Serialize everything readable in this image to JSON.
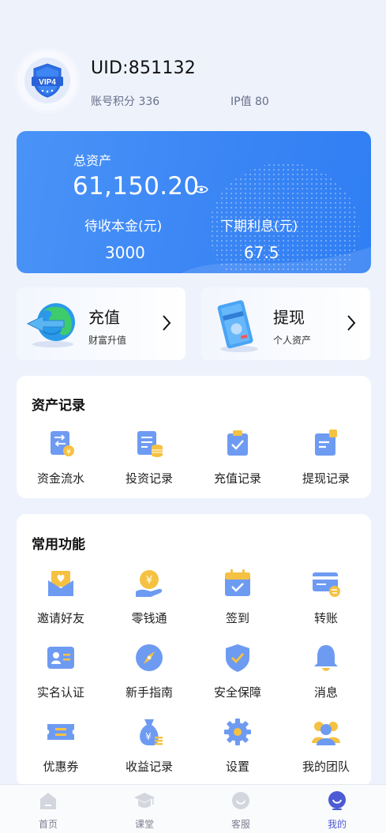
{
  "profile": {
    "uid": "UID:851132",
    "score": "账号积分 336",
    "ip": "IP值 80",
    "badge_text": "VIP4"
  },
  "assets": {
    "total_label": "总资产",
    "total_value": "61,150.20",
    "principal_label": "待收本金(元)",
    "principal_value": "3000",
    "interest_label": "下期利息(元)",
    "interest_value": "67.5"
  },
  "actions": {
    "recharge_title": "充值",
    "recharge_sub": "财富升值",
    "withdraw_title": "提现",
    "withdraw_sub": "个人资产"
  },
  "records": {
    "title": "资产记录",
    "items": [
      {
        "label": "资金流水",
        "icon": "fund-flow-icon"
      },
      {
        "label": "投资记录",
        "icon": "invest-record-icon"
      },
      {
        "label": "充值记录",
        "icon": "recharge-record-icon"
      },
      {
        "label": "提现记录",
        "icon": "withdraw-record-icon"
      }
    ]
  },
  "functions": {
    "title": "常用功能",
    "items": [
      {
        "label": "邀请好友",
        "icon": "invite-envelope-icon"
      },
      {
        "label": "零钱通",
        "icon": "yuan-hand-icon"
      },
      {
        "label": "签到",
        "icon": "calendar-check-icon"
      },
      {
        "label": "转账",
        "icon": "transfer-card-icon"
      },
      {
        "label": "实名认证",
        "icon": "id-card-icon"
      },
      {
        "label": "新手指南",
        "icon": "compass-icon"
      },
      {
        "label": "安全保障",
        "icon": "shield-check-icon"
      },
      {
        "label": "消息",
        "icon": "bell-icon"
      },
      {
        "label": "优惠券",
        "icon": "coupon-icon"
      },
      {
        "label": "收益记录",
        "icon": "money-bag-icon"
      },
      {
        "label": "设置",
        "icon": "gear-icon"
      },
      {
        "label": "我的团队",
        "icon": "team-icon"
      }
    ]
  },
  "tabbar": [
    {
      "label": "首页",
      "icon": "home-icon"
    },
    {
      "label": "课堂",
      "icon": "graduation-cap-icon"
    },
    {
      "label": "客服",
      "icon": "customer-service-icon"
    },
    {
      "label": "我的",
      "icon": "user-icon",
      "active": true
    }
  ],
  "colors": {
    "accent_blue": "#3b86f5",
    "icon_blue": "#6e9bf2",
    "icon_yellow": "#f5c142",
    "active_tab": "#4c5bd4"
  }
}
